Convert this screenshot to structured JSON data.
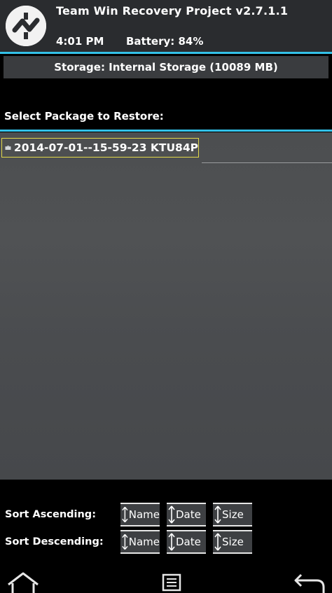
{
  "header": {
    "title": "Team Win Recovery Project  v2.7.1.1",
    "time": "4:01 PM",
    "battery": "Battery: 84%"
  },
  "storage": {
    "label": "Storage: Internal Storage (10089 MB)"
  },
  "restore": {
    "select_label": "Select Package to Restore:",
    "packages": [
      {
        "name": "2014-07-01--15-59-23 KTU84P",
        "icon": "folder-icon"
      }
    ]
  },
  "sort": {
    "ascending_label": "Sort Ascending:",
    "descending_label": "Sort Descending:",
    "buttons": [
      "Name",
      "Date",
      "Size"
    ]
  },
  "nav": {
    "icons": [
      "home-icon",
      "console-log-icon",
      "back-icon"
    ]
  },
  "colors": {
    "accent": "#33c1e8",
    "selection": "#e2d84a",
    "header_bg": "#2a2c2f"
  }
}
